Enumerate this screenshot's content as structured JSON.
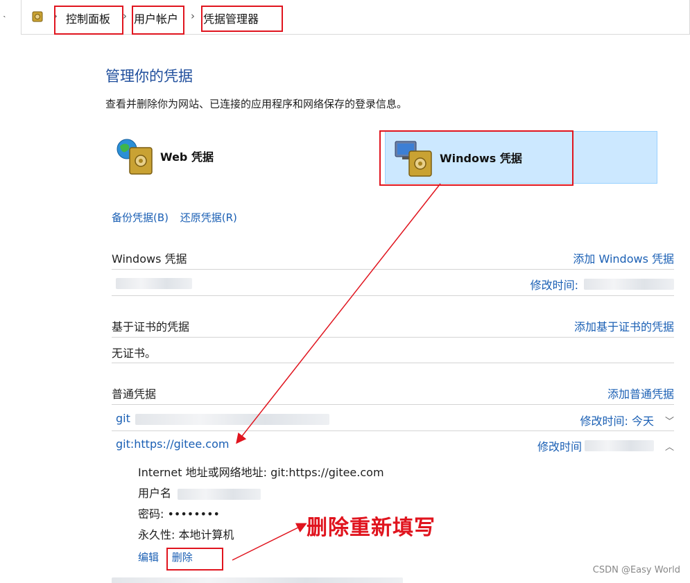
{
  "breadcrumb": {
    "items": [
      "控制面板",
      "用户帐户",
      "凭据管理器"
    ]
  },
  "page": {
    "title": "管理你的凭据",
    "subtitle": "查看并删除你为网站、已连接的应用程序和网络保存的登录信息。"
  },
  "tiles": {
    "web_label": "Web 凭据",
    "windows_label": "Windows 凭据"
  },
  "actions": {
    "backup": "备份凭据(B)",
    "restore": "还原凭据(R)"
  },
  "sections": {
    "windows": {
      "title": "Windows 凭据",
      "add": "添加 Windows 凭据",
      "row_modified_label": "修改时间:"
    },
    "cert": {
      "title": "基于证书的凭据",
      "add": "添加基于证书的凭据",
      "empty": "无证书。"
    },
    "generic": {
      "title": "普通凭据",
      "add": "添加普通凭据",
      "row1_prefix": "git",
      "row1_modified": "修改时间:  今天",
      "row2_name": "git:https://gitee.com",
      "row2_modified": "修改时间"
    }
  },
  "detail": {
    "address": "Internet 地址或网络地址:  git:https://gitee.com",
    "username": "用户名",
    "password": "密码:  ••••••••",
    "persistence": "永久性:  本地计算机",
    "edit": "编辑",
    "delete": "删除"
  },
  "annotation": {
    "text": "删除重新填写"
  },
  "watermark": "CSDN @Easy World",
  "colors": {
    "annotation_red": "#e0141e",
    "link_blue": "#1a5fb4",
    "title_blue": "#1f4e9c",
    "selected_tile": "#cce8ff"
  }
}
